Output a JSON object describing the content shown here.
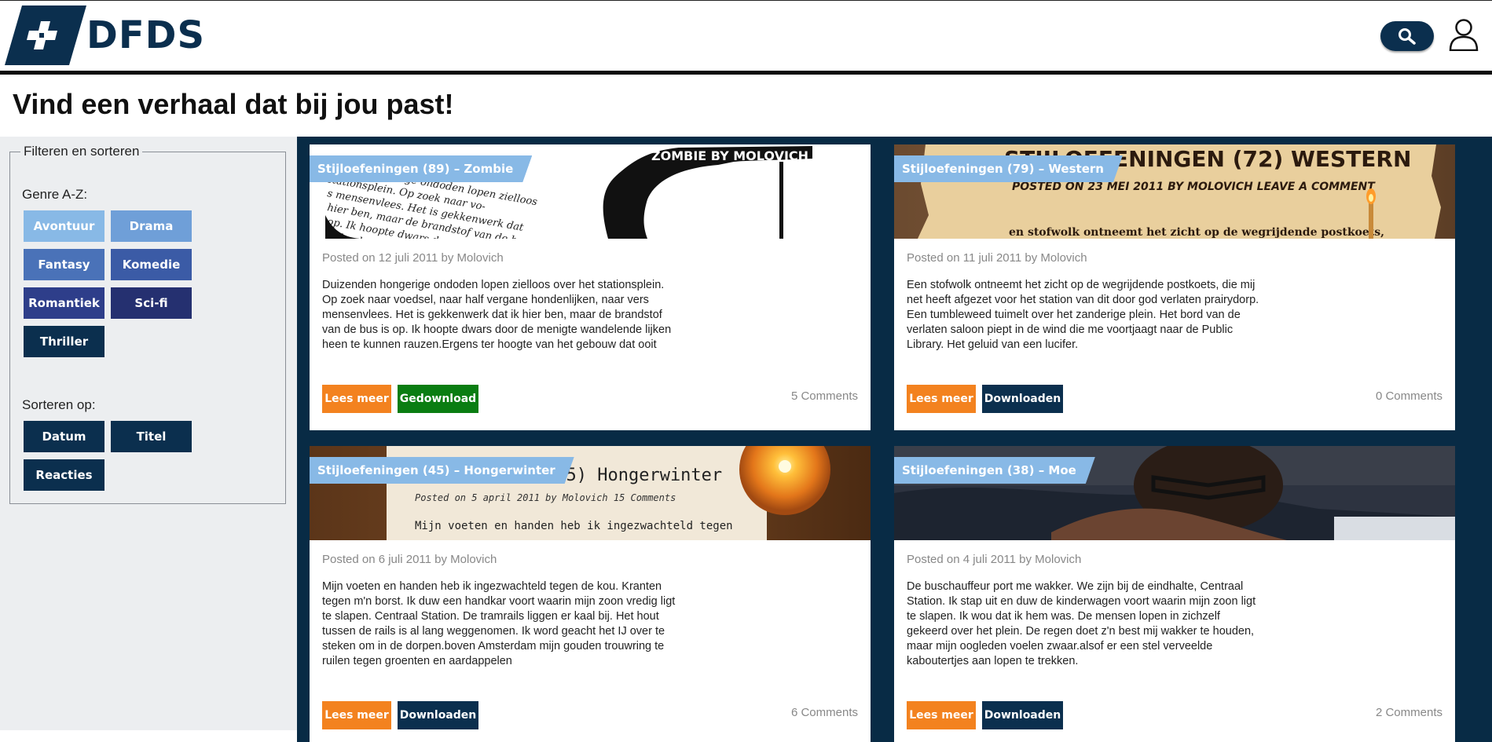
{
  "header": {
    "logo_text": "DFDS",
    "brand_color": "#0b2f4e"
  },
  "page": {
    "title": "Vind een verhaal dat bij jou past!"
  },
  "sidebar": {
    "legend": "Filteren en sorteren",
    "genre_label": "Genre A-Z:",
    "genres": [
      {
        "label": "Avontuur",
        "color": "#88b9e6"
      },
      {
        "label": "Drama",
        "color": "#6f9fd8"
      },
      {
        "label": "Fantasy",
        "color": "#4a72b8"
      },
      {
        "label": "Komedie",
        "color": "#3b5ba6"
      },
      {
        "label": "Romantiek",
        "color": "#2e3e8a"
      },
      {
        "label": "Sci-fi",
        "color": "#253070"
      },
      {
        "label": "Thriller",
        "color": "#0b2f4e"
      }
    ],
    "sort_label": "Sorteren op:",
    "sorts": [
      {
        "label": "Datum"
      },
      {
        "label": "Titel"
      },
      {
        "label": "Reacties"
      }
    ]
  },
  "stories": [
    {
      "tag": "Stijloefeningen (89) – Zombie",
      "meta": "Posted on 12 juli 2011 by Molovich",
      "excerpt": "Duizenden hongerige ondoden lopen zielloos over het stationsplein. Op zoek naar voedsel, naar half vergane hondenlijken, naar vers mensenvlees. Het is gekkenwerk dat ik hier ben, maar de brandstof van de bus is op. Ik hoopte dwars door de menigte wandelende lijken heen te kunnen rauzen.Ergens ter hoogte van het gebouw dat ooit",
      "read_label": "Lees meer",
      "download_label": "Gedownload",
      "download_color": "#0a7d12",
      "comments": "5 Comments",
      "banner_text": "ZOMBIE BY MOLOVICH"
    },
    {
      "tag": "Stijloefeningen (79) – Western",
      "meta": "Posted on 11 juli 2011 by Molovich",
      "excerpt": "Een stofwolk ontneemt het zicht op de wegrijdende postkoets, die mij net heeft afgezet voor het station van dit door god verlaten prairydorp. Een tumbleweed tuimelt over het zanderige plein. Het bord van de verlaten saloon piept in de wind die me voortjaagt naar de Public Library. Het geluid van een lucifer.",
      "read_label": "Lees meer",
      "download_label": "Downloaden",
      "download_color": "#0b2f4e",
      "comments": "0 Comments",
      "banner_text": "STIJLOEFENINGEN (72) WESTERN",
      "banner_sub": "POSTED ON 23 MEI 2011 BY MOLOVICH LEAVE A COMMENT",
      "banner_line": "en stofwolk ontneemt het zicht op de wegrijdende postkoets,"
    },
    {
      "tag": "Stijloefeningen (45) – Hongerwinter",
      "meta": "Posted on 6 juli 2011 by Molovich",
      "excerpt": "Mijn voeten en handen heb ik ingezwachteld tegen de kou. Kranten tegen m'n borst. Ik duw een handkar voort waarin mijn zoon vredig ligt te slapen. Centraal Station. De tramrails liggen er kaal bij. Het hout tussen de rails is al lang weggenomen. Ik word geacht het IJ over te steken om in de dorpen.boven Amsterdam mijn gouden trouwring te ruilen tegen groenten en aardappelen",
      "read_label": "Lees meer",
      "download_label": "Downloaden",
      "download_color": "#0b2f4e",
      "comments": "6 Comments",
      "banner_text": "(45)  Hongerwinter",
      "banner_sub": "Posted on 5 april 2011 by Molovich 15 Comments",
      "banner_line": "Mijn voeten en handen heb ik ingezwachteld tegen"
    },
    {
      "tag": "Stijloefeningen (38) – Moe",
      "meta": "Posted on 4 juli 2011 by Molovich",
      "excerpt": "De buschauffeur port me wakker. We zijn bij de eindhalte, Centraal Station. Ik stap uit en duw de kinderwagen voort waarin mijn zoon ligt te slapen. Ik wou dat ik hem was. De mensen lopen in zichzelf gekeerd over het plein. De regen doet z'n best mij wakker te houden, maar mijn oogleden voelen zwaar.alsof er een stel verveelde kaboutertjes aan lopen te trekken.",
      "read_label": "Lees meer",
      "download_label": "Downloaden",
      "download_color": "#0b2f4e",
      "comments": "2 Comments"
    }
  ]
}
